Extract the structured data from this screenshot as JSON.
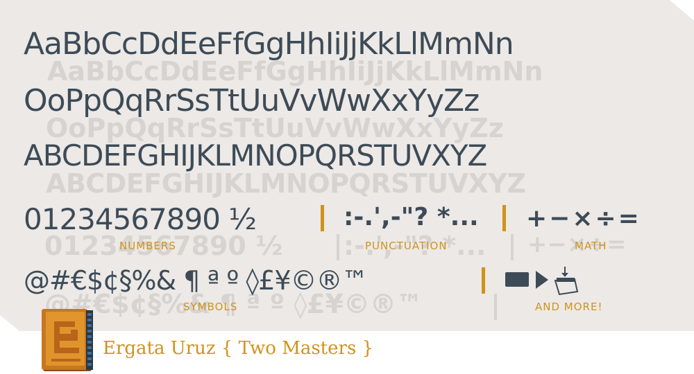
{
  "specimen": {
    "row1": "AaBbCcDdEeFfGgHhIiJjKkLlMmNn",
    "row2": "OoPpQqRrSsTtUuVvWwXxYyZz",
    "row3": "ABCDEFGHIJKLMNOPQRSTUVXYZ",
    "numbers": "01234567890 ½",
    "punctuation": ":-.',-\"? *...",
    "math": "+−×÷=",
    "symbols": "@#€$¢§%& ¶ ª º ◊£¥©®™"
  },
  "labels": {
    "numbers": "NUMBERS",
    "punctuation": "PUNCTUATION",
    "math": "MATH",
    "symbols": "SYMBOLS",
    "more": "AND MORE!"
  },
  "footer": {
    "title": "Ergata Uruz { Two Masters }"
  },
  "colors": {
    "text": "#3d4b57",
    "ghost": "#d6d3d0",
    "accent": "#d1921b",
    "background": "#ece9e6"
  }
}
